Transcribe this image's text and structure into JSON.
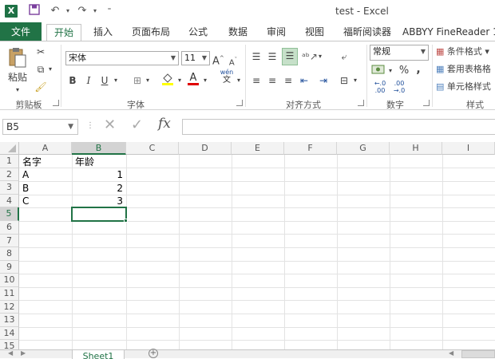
{
  "window": {
    "title": "test - Excel"
  },
  "quick_access": {
    "save_icon": "save-icon",
    "undo_icon": "undo-icon",
    "redo_icon": "redo-icon"
  },
  "tabs": [
    {
      "label": "文件"
    },
    {
      "label": "开始"
    },
    {
      "label": "插入"
    },
    {
      "label": "页面布局"
    },
    {
      "label": "公式"
    },
    {
      "label": "数据"
    },
    {
      "label": "审阅"
    },
    {
      "label": "视图"
    },
    {
      "label": "福昕阅读器"
    },
    {
      "label": "ABBYY FineReader 1"
    }
  ],
  "ribbon": {
    "clipboard": {
      "paste_label": "粘贴",
      "group_label": "剪贴板"
    },
    "font": {
      "font_name": "宋体",
      "font_size": "11",
      "bold": "B",
      "italic": "I",
      "underline": "U",
      "grow": "A",
      "shrink": "A",
      "group_label": "字体",
      "wen": "wén"
    },
    "alignment": {
      "group_label": "对齐方式"
    },
    "number": {
      "format": "常规",
      "percent": "%",
      "comma": ",",
      "inc_dec": ".0\n.00",
      "group_label": "数字"
    },
    "styles": {
      "conditional": "条件格式",
      "table_format": "套用表格格",
      "cell_styles": "单元格样式",
      "group_label": "样式"
    }
  },
  "formula_bar": {
    "name_box": "B5",
    "fx": "fx",
    "value": ""
  },
  "grid": {
    "columns": [
      "A",
      "B",
      "C",
      "D",
      "E",
      "F",
      "G",
      "H",
      "I"
    ],
    "selected_column": "B",
    "rows": [
      "1",
      "2",
      "3",
      "4",
      "5",
      "6",
      "7",
      "8",
      "9",
      "10",
      "11",
      "12",
      "13",
      "14",
      "15"
    ],
    "selected_row": "5",
    "cells": {
      "A1": "名字",
      "B1": "年龄",
      "A2": "A",
      "B2": "1",
      "A3": "B",
      "B3": "2",
      "A4": "C",
      "B4": "3"
    }
  },
  "sheets": [
    {
      "label": "Sheet1"
    }
  ],
  "colors": {
    "accent": "#217346",
    "grid_line": "#e3e3e3"
  }
}
